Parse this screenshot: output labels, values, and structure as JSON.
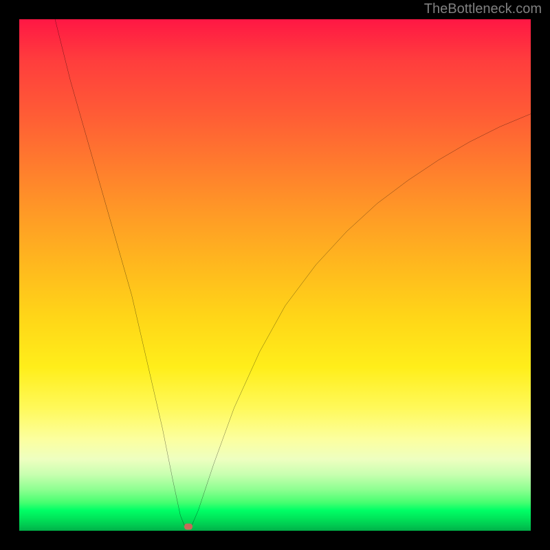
{
  "watermark": "TheBottleneck.com",
  "colors": {
    "frame": "#000000",
    "curve": "#000000",
    "marker": "#c6695a",
    "gradient_top": "#ff1744",
    "gradient_mid": "#ffee1a",
    "gradient_bottom": "#00c850"
  },
  "chart_data": {
    "type": "line",
    "title": "",
    "xlabel": "",
    "ylabel": "",
    "xlim": [
      0,
      100
    ],
    "ylim": [
      0,
      100
    ],
    "series": [
      {
        "name": "bottleneck-curve",
        "x": [
          7,
          10,
          14,
          18,
          22,
          25,
          28,
          30,
          31.5,
          32.5,
          33.5,
          35,
          38,
          42,
          47,
          52,
          58,
          64,
          70,
          76,
          82,
          88,
          94,
          100
        ],
        "y": [
          100,
          88,
          74,
          60,
          46,
          33,
          20,
          10,
          3,
          0.5,
          0.5,
          4,
          13,
          24,
          35,
          44,
          52,
          58.5,
          64,
          68.5,
          72.5,
          76,
          79,
          81.5
        ]
      }
    ],
    "marker": {
      "x": 33,
      "y": 0.8
    },
    "annotations": []
  }
}
